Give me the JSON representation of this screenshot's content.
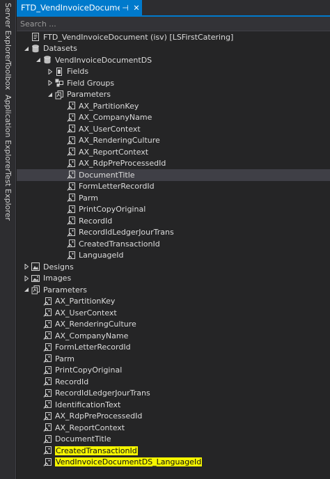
{
  "side_tabs": [
    "Server Explorer",
    "Toolbox",
    "Application Explorer",
    "Test Explorer"
  ],
  "tab": {
    "title": "FTD_VendInvoiceDocument",
    "pin": "⊣",
    "close": "✕"
  },
  "search": {
    "placeholder": "Search ..."
  },
  "highlight_color": "#f5f500",
  "tree": [
    {
      "label": "FTD_VendInvoiceDocument (isv) [LSFirstCatering]",
      "level": 0,
      "arrow": "none",
      "icon": "report-icon"
    },
    {
      "label": "Datasets",
      "level": 0,
      "arrow": "expanded",
      "icon": "database-icon"
    },
    {
      "label": "VendInvoiceDocumentDS",
      "level": 1,
      "arrow": "expanded",
      "icon": "database-icon"
    },
    {
      "label": "Fields",
      "level": 2,
      "arrow": "collapsed",
      "icon": "field-icon"
    },
    {
      "label": "Field Groups",
      "level": 2,
      "arrow": "collapsed",
      "icon": "field-group-icon"
    },
    {
      "label": "Parameters",
      "level": 2,
      "arrow": "expanded",
      "icon": "parameters-icon"
    },
    {
      "label": "AX_PartitionKey",
      "level": 3,
      "arrow": "none",
      "icon": "parameter-icon"
    },
    {
      "label": "AX_CompanyName",
      "level": 3,
      "arrow": "none",
      "icon": "parameter-icon"
    },
    {
      "label": "AX_UserContext",
      "level": 3,
      "arrow": "none",
      "icon": "parameter-icon"
    },
    {
      "label": "AX_RenderingCulture",
      "level": 3,
      "arrow": "none",
      "icon": "parameter-icon"
    },
    {
      "label": "AX_ReportContext",
      "level": 3,
      "arrow": "none",
      "icon": "parameter-icon"
    },
    {
      "label": "AX_RdpPreProcessedId",
      "level": 3,
      "arrow": "none",
      "icon": "parameter-icon"
    },
    {
      "label": "DocumentTitle",
      "level": 3,
      "arrow": "none",
      "icon": "parameter-icon",
      "selected": true
    },
    {
      "label": "FormLetterRecordId",
      "level": 3,
      "arrow": "none",
      "icon": "parameter-icon"
    },
    {
      "label": "Parm",
      "level": 3,
      "arrow": "none",
      "icon": "parameter-icon"
    },
    {
      "label": "PrintCopyOriginal",
      "level": 3,
      "arrow": "none",
      "icon": "parameter-icon"
    },
    {
      "label": "RecordId",
      "level": 3,
      "arrow": "none",
      "icon": "parameter-icon"
    },
    {
      "label": "RecordIdLedgerJourTrans",
      "level": 3,
      "arrow": "none",
      "icon": "parameter-icon"
    },
    {
      "label": "CreatedTransactionId",
      "level": 3,
      "arrow": "none",
      "icon": "parameter-icon"
    },
    {
      "label": "LanguageId",
      "level": 3,
      "arrow": "none",
      "icon": "parameter-icon"
    },
    {
      "label": "Designs",
      "level": 0,
      "arrow": "collapsed",
      "icon": "designs-icon"
    },
    {
      "label": "Images",
      "level": 0,
      "arrow": "collapsed",
      "icon": "images-icon"
    },
    {
      "label": "Parameters",
      "level": 0,
      "arrow": "expanded",
      "icon": "parameters-icon"
    },
    {
      "label": "AX_PartitionKey",
      "level": 1,
      "arrow": "none",
      "icon": "parameter-icon"
    },
    {
      "label": "AX_UserContext",
      "level": 1,
      "arrow": "none",
      "icon": "parameter-icon"
    },
    {
      "label": "AX_RenderingCulture",
      "level": 1,
      "arrow": "none",
      "icon": "parameter-icon"
    },
    {
      "label": "AX_CompanyName",
      "level": 1,
      "arrow": "none",
      "icon": "parameter-icon"
    },
    {
      "label": "FormLetterRecordId",
      "level": 1,
      "arrow": "none",
      "icon": "parameter-icon"
    },
    {
      "label": "Parm",
      "level": 1,
      "arrow": "none",
      "icon": "parameter-icon"
    },
    {
      "label": "PrintCopyOriginal",
      "level": 1,
      "arrow": "none",
      "icon": "parameter-icon"
    },
    {
      "label": "RecordId",
      "level": 1,
      "arrow": "none",
      "icon": "parameter-icon"
    },
    {
      "label": "RecordIdLedgerJourTrans",
      "level": 1,
      "arrow": "none",
      "icon": "parameter-icon"
    },
    {
      "label": "IdentificationText",
      "level": 1,
      "arrow": "none",
      "icon": "parameter-icon"
    },
    {
      "label": "AX_RdpPreProcessedId",
      "level": 1,
      "arrow": "none",
      "icon": "parameter-icon"
    },
    {
      "label": "AX_ReportContext",
      "level": 1,
      "arrow": "none",
      "icon": "parameter-icon"
    },
    {
      "label": "DocumentTitle",
      "level": 1,
      "arrow": "none",
      "icon": "parameter-icon"
    },
    {
      "label": "CreatedTransactionId",
      "level": 1,
      "arrow": "none",
      "icon": "parameter-icon",
      "highlighted": true
    },
    {
      "label": "VendInvoiceDocumentDS_LanguageId",
      "level": 1,
      "arrow": "none",
      "icon": "parameter-icon",
      "highlighted": true
    }
  ]
}
